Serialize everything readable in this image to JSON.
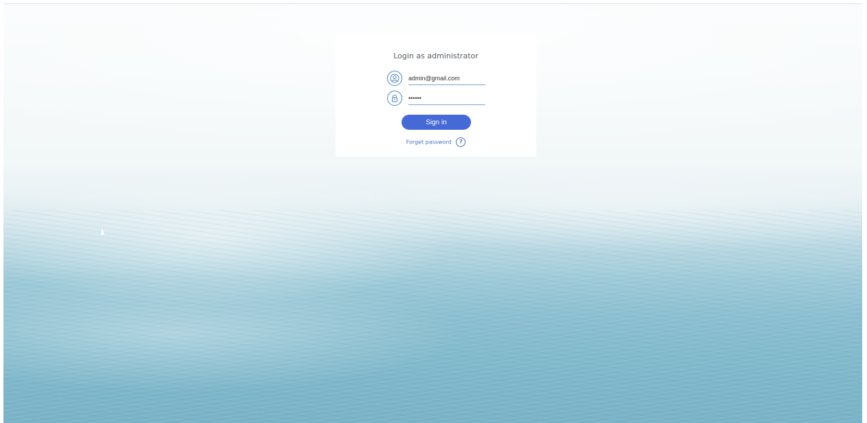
{
  "login": {
    "title": "Login as administrator",
    "email_value": "admin@gmail.com",
    "password_value": "••••••",
    "signin_label": "Sign in",
    "forget_label": "Forget password",
    "help_glyph": "?",
    "icons": {
      "email": "user-icon",
      "password": "lock-icon",
      "help": "question-mark-icon"
    },
    "colors": {
      "accent": "#4569d6",
      "link": "#4a74c4",
      "icon": "#4a86c5"
    }
  }
}
